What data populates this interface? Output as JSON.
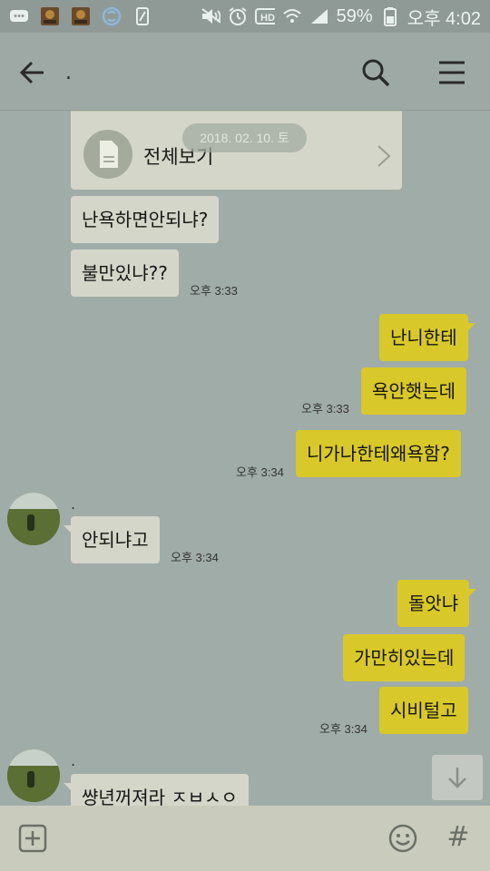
{
  "status_bar": {
    "battery": "59%",
    "time": "오후 4:02",
    "icons": [
      "message-icon",
      "app-icon",
      "app-icon",
      "sync-icon",
      "phone-icon",
      "mute-icon",
      "alarm-icon",
      "hd-icon",
      "wifi-icon",
      "signal-icon",
      "battery-icon"
    ]
  },
  "header": {
    "title": ".",
    "icons": [
      "back-arrow-icon",
      "search-icon",
      "menu-icon"
    ]
  },
  "notice": {
    "label": "전체보기",
    "date": "2018. 02. 10. 토"
  },
  "messages": [
    {
      "side": "in",
      "text": "난욕하면안되냐?"
    },
    {
      "side": "in",
      "text": "불만있냐??",
      "time": "오후 3:33"
    },
    {
      "side": "out",
      "text": "난니한테"
    },
    {
      "side": "out",
      "text": "욕안햇는데",
      "time": "오후 3:33"
    },
    {
      "side": "out",
      "text": "니가나한테왜욕함?",
      "time": "오후 3:34"
    },
    {
      "side": "in",
      "sender": ".",
      "text": "안되냐고",
      "time": "오후 3:34"
    },
    {
      "side": "out",
      "text": "돌앗냐"
    },
    {
      "side": "out",
      "text": "가만히있는데"
    },
    {
      "side": "out",
      "text": "시비털고",
      "time": "오후 3:34"
    },
    {
      "side": "in",
      "sender": ".",
      "text": "썅년꺼져라 ㅈㅂㅅㅇ"
    }
  ],
  "input_bar": {
    "hash": "#",
    "icons": [
      "plus-icon",
      "emoji-icon",
      "hash-icon"
    ]
  },
  "colors": {
    "background": "#a0aca8",
    "incoming_bubble": "#d4d6c9",
    "outgoing_bubble": "#d9c82a"
  }
}
